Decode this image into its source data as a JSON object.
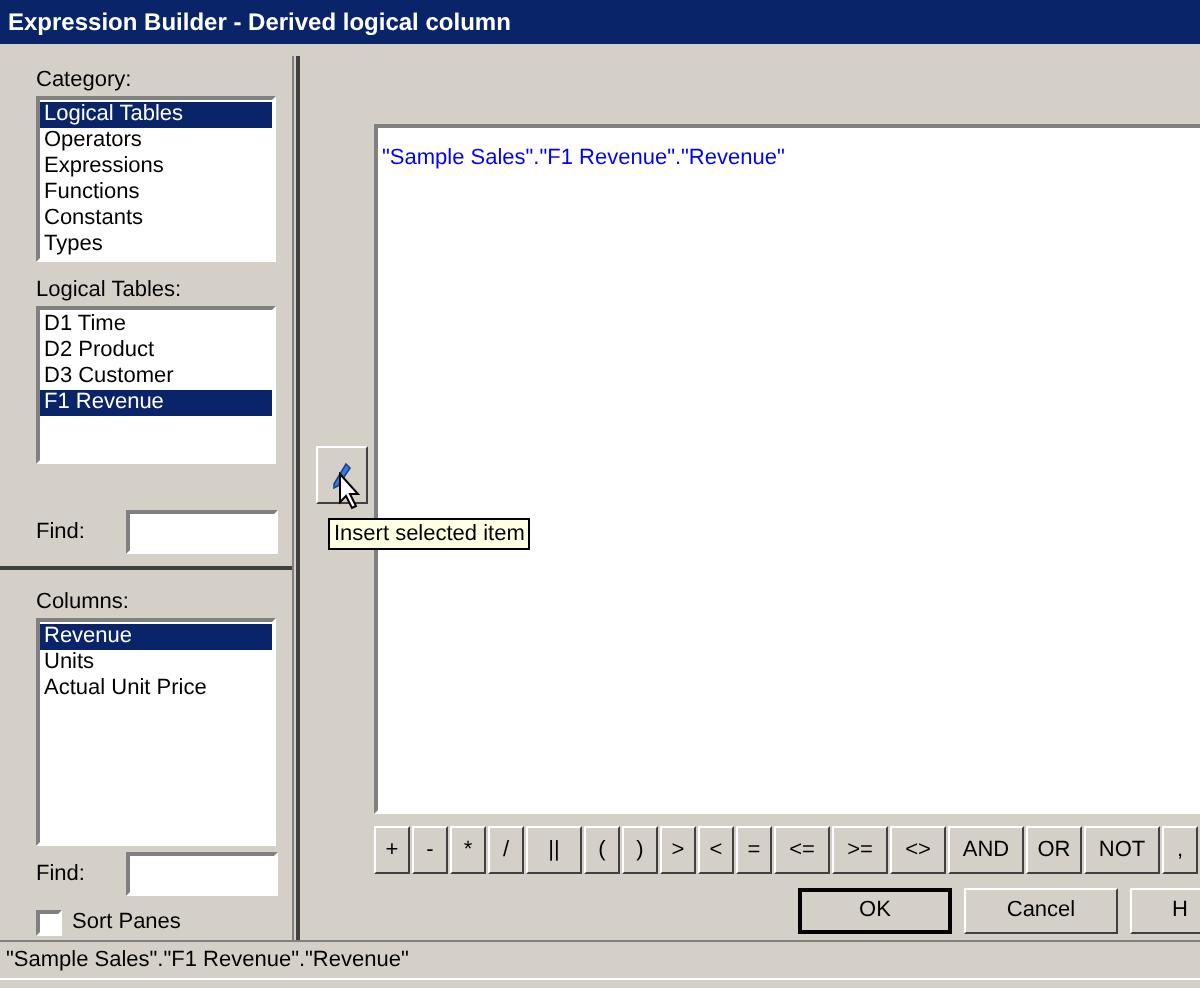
{
  "window": {
    "title": "Expression Builder - Derived logical column"
  },
  "category": {
    "label": "Category:",
    "items": [
      {
        "label": "Logical Tables",
        "selected": true
      },
      {
        "label": "Operators",
        "selected": false
      },
      {
        "label": "Expressions",
        "selected": false
      },
      {
        "label": "Functions",
        "selected": false
      },
      {
        "label": "Constants",
        "selected": false
      },
      {
        "label": "Types",
        "selected": false
      }
    ]
  },
  "logical_tables": {
    "label": "Logical Tables:",
    "items": [
      {
        "label": "D1 Time",
        "selected": false
      },
      {
        "label": "D2 Product",
        "selected": false
      },
      {
        "label": "D3 Customer",
        "selected": false
      },
      {
        "label": "F1 Revenue",
        "selected": true
      }
    ],
    "find_label": "Find:"
  },
  "columns": {
    "label": "Columns:",
    "items": [
      {
        "label": "Revenue",
        "selected": true
      },
      {
        "label": "Units",
        "selected": false
      },
      {
        "label": "Actual Unit Price",
        "selected": false
      }
    ],
    "find_label": "Find:"
  },
  "sort_panes": {
    "label": "Sort Panes",
    "checked": false
  },
  "insert_button": {
    "tooltip": "Insert selected item"
  },
  "expression": "\"Sample Sales\".\"F1 Revenue\".\"Revenue\"",
  "operators": [
    "+",
    "-",
    "*",
    "/",
    "||",
    "(",
    ")",
    ">",
    "<",
    "=",
    "<=",
    ">=",
    "<>",
    "AND",
    "OR",
    "NOT",
    ","
  ],
  "buttons": [
    {
      "label": "OK",
      "default": true
    },
    {
      "label": "Cancel",
      "default": false
    },
    {
      "label": "H",
      "default": false
    }
  ],
  "status_bar": "\"Sample Sales\".\"F1 Revenue\".\"Revenue\""
}
